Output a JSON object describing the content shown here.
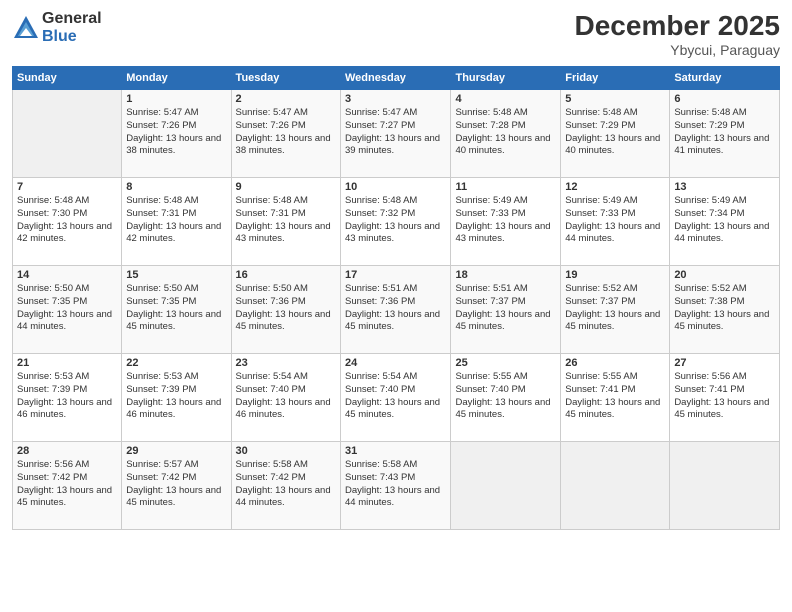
{
  "logo": {
    "general": "General",
    "blue": "Blue"
  },
  "header": {
    "month": "December 2025",
    "location": "Ybycui, Paraguay"
  },
  "days_of_week": [
    "Sunday",
    "Monday",
    "Tuesday",
    "Wednesday",
    "Thursday",
    "Friday",
    "Saturday"
  ],
  "weeks": [
    [
      {
        "day": "",
        "info": ""
      },
      {
        "day": "1",
        "info": "Sunrise: 5:47 AM\nSunset: 7:26 PM\nDaylight: 13 hours\nand 38 minutes."
      },
      {
        "day": "2",
        "info": "Sunrise: 5:47 AM\nSunset: 7:26 PM\nDaylight: 13 hours\nand 38 minutes."
      },
      {
        "day": "3",
        "info": "Sunrise: 5:47 AM\nSunset: 7:27 PM\nDaylight: 13 hours\nand 39 minutes."
      },
      {
        "day": "4",
        "info": "Sunrise: 5:48 AM\nSunset: 7:28 PM\nDaylight: 13 hours\nand 40 minutes."
      },
      {
        "day": "5",
        "info": "Sunrise: 5:48 AM\nSunset: 7:29 PM\nDaylight: 13 hours\nand 40 minutes."
      },
      {
        "day": "6",
        "info": "Sunrise: 5:48 AM\nSunset: 7:29 PM\nDaylight: 13 hours\nand 41 minutes."
      }
    ],
    [
      {
        "day": "7",
        "info": "Sunrise: 5:48 AM\nSunset: 7:30 PM\nDaylight: 13 hours\nand 42 minutes."
      },
      {
        "day": "8",
        "info": "Sunrise: 5:48 AM\nSunset: 7:31 PM\nDaylight: 13 hours\nand 42 minutes."
      },
      {
        "day": "9",
        "info": "Sunrise: 5:48 AM\nSunset: 7:31 PM\nDaylight: 13 hours\nand 43 minutes."
      },
      {
        "day": "10",
        "info": "Sunrise: 5:48 AM\nSunset: 7:32 PM\nDaylight: 13 hours\nand 43 minutes."
      },
      {
        "day": "11",
        "info": "Sunrise: 5:49 AM\nSunset: 7:33 PM\nDaylight: 13 hours\nand 43 minutes."
      },
      {
        "day": "12",
        "info": "Sunrise: 5:49 AM\nSunset: 7:33 PM\nDaylight: 13 hours\nand 44 minutes."
      },
      {
        "day": "13",
        "info": "Sunrise: 5:49 AM\nSunset: 7:34 PM\nDaylight: 13 hours\nand 44 minutes."
      }
    ],
    [
      {
        "day": "14",
        "info": "Sunrise: 5:50 AM\nSunset: 7:35 PM\nDaylight: 13 hours\nand 44 minutes."
      },
      {
        "day": "15",
        "info": "Sunrise: 5:50 AM\nSunset: 7:35 PM\nDaylight: 13 hours\nand 45 minutes."
      },
      {
        "day": "16",
        "info": "Sunrise: 5:50 AM\nSunset: 7:36 PM\nDaylight: 13 hours\nand 45 minutes."
      },
      {
        "day": "17",
        "info": "Sunrise: 5:51 AM\nSunset: 7:36 PM\nDaylight: 13 hours\nand 45 minutes."
      },
      {
        "day": "18",
        "info": "Sunrise: 5:51 AM\nSunset: 7:37 PM\nDaylight: 13 hours\nand 45 minutes."
      },
      {
        "day": "19",
        "info": "Sunrise: 5:52 AM\nSunset: 7:37 PM\nDaylight: 13 hours\nand 45 minutes."
      },
      {
        "day": "20",
        "info": "Sunrise: 5:52 AM\nSunset: 7:38 PM\nDaylight: 13 hours\nand 45 minutes."
      }
    ],
    [
      {
        "day": "21",
        "info": "Sunrise: 5:53 AM\nSunset: 7:39 PM\nDaylight: 13 hours\nand 46 minutes."
      },
      {
        "day": "22",
        "info": "Sunrise: 5:53 AM\nSunset: 7:39 PM\nDaylight: 13 hours\nand 46 minutes."
      },
      {
        "day": "23",
        "info": "Sunrise: 5:54 AM\nSunset: 7:40 PM\nDaylight: 13 hours\nand 46 minutes."
      },
      {
        "day": "24",
        "info": "Sunrise: 5:54 AM\nSunset: 7:40 PM\nDaylight: 13 hours\nand 45 minutes."
      },
      {
        "day": "25",
        "info": "Sunrise: 5:55 AM\nSunset: 7:40 PM\nDaylight: 13 hours\nand 45 minutes."
      },
      {
        "day": "26",
        "info": "Sunrise: 5:55 AM\nSunset: 7:41 PM\nDaylight: 13 hours\nand 45 minutes."
      },
      {
        "day": "27",
        "info": "Sunrise: 5:56 AM\nSunset: 7:41 PM\nDaylight: 13 hours\nand 45 minutes."
      }
    ],
    [
      {
        "day": "28",
        "info": "Sunrise: 5:56 AM\nSunset: 7:42 PM\nDaylight: 13 hours\nand 45 minutes."
      },
      {
        "day": "29",
        "info": "Sunrise: 5:57 AM\nSunset: 7:42 PM\nDaylight: 13 hours\nand 45 minutes."
      },
      {
        "day": "30",
        "info": "Sunrise: 5:58 AM\nSunset: 7:42 PM\nDaylight: 13 hours\nand 44 minutes."
      },
      {
        "day": "31",
        "info": "Sunrise: 5:58 AM\nSunset: 7:43 PM\nDaylight: 13 hours\nand 44 minutes."
      },
      {
        "day": "",
        "info": ""
      },
      {
        "day": "",
        "info": ""
      },
      {
        "day": "",
        "info": ""
      }
    ]
  ]
}
